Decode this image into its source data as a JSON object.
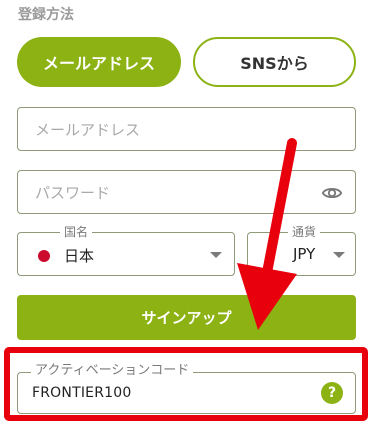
{
  "form": {
    "section_title": "登録方法",
    "tabs": [
      {
        "label": "メールアドレス",
        "active": true
      },
      {
        "label": "SNSから",
        "active": false
      }
    ],
    "email": {
      "placeholder": "メールアドレス"
    },
    "password": {
      "placeholder": "パスワード",
      "icon": "eye-icon"
    },
    "country": {
      "legend": "国名",
      "value": "日本",
      "flag_color": "#cc0a2e"
    },
    "currency": {
      "legend": "通貨",
      "value": "JPY"
    },
    "signup_label": "サインアップ",
    "activation": {
      "legend": "アクティベーションコード",
      "value": "FRONTIER100",
      "help_symbol": "?"
    }
  },
  "colors": {
    "accent": "#8cb214",
    "highlight": "#e8000c",
    "border": "#8e9a78"
  }
}
